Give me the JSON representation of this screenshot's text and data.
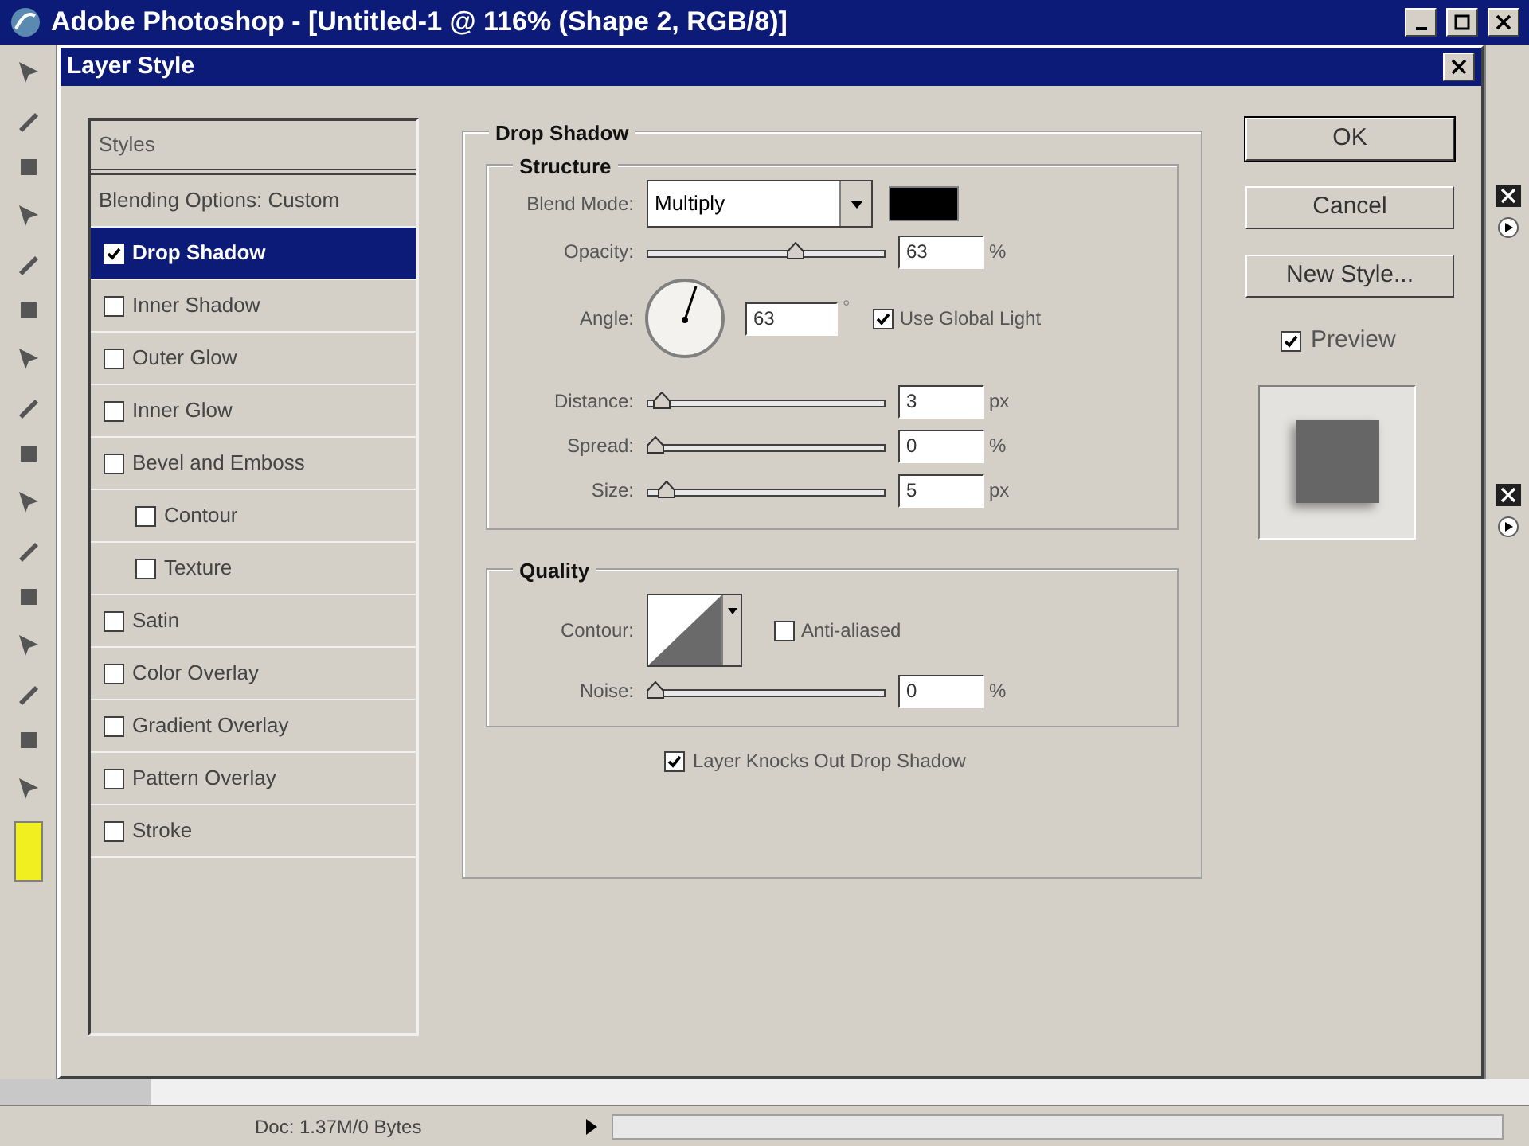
{
  "app_title": "Adobe Photoshop - [Untitled-1 @ 116% (Shape 2, RGB/8)]",
  "dialog": {
    "title": "Layer Style"
  },
  "styles": {
    "header": "Styles",
    "items": [
      {
        "label": "Blending Options: Custom",
        "kind": "plain",
        "selected": false
      },
      {
        "label": "Drop Shadow",
        "kind": "effect",
        "checked": true,
        "selected": true
      },
      {
        "label": "Inner Shadow",
        "kind": "effect",
        "checked": false,
        "selected": false
      },
      {
        "label": "Outer Glow",
        "kind": "effect",
        "checked": false,
        "selected": false
      },
      {
        "label": "Inner Glow",
        "kind": "effect",
        "checked": false,
        "selected": false
      },
      {
        "label": "Bevel and Emboss",
        "kind": "effect",
        "checked": false,
        "selected": false,
        "children": [
          {
            "label": "Contour",
            "kind": "effect",
            "checked": false,
            "selected": false
          },
          {
            "label": "Texture",
            "kind": "effect",
            "checked": false,
            "selected": false
          }
        ]
      },
      {
        "label": "Satin",
        "kind": "effect",
        "checked": false,
        "selected": false
      },
      {
        "label": "Color Overlay",
        "kind": "effect",
        "checked": false,
        "selected": false
      },
      {
        "label": "Gradient Overlay",
        "kind": "effect",
        "checked": false,
        "selected": false
      },
      {
        "label": "Pattern Overlay",
        "kind": "effect",
        "checked": false,
        "selected": false
      },
      {
        "label": "Stroke",
        "kind": "effect",
        "checked": false,
        "selected": false
      }
    ]
  },
  "drop_shadow": {
    "title": "Drop Shadow",
    "structure": {
      "title": "Structure",
      "blend_mode": {
        "label": "Blend Mode:",
        "value": "Multiply",
        "color": "#000000"
      },
      "opacity": {
        "label": "Opacity:",
        "level": 0.63,
        "value": "63",
        "unit": "%"
      },
      "angle": {
        "label": "Angle:",
        "value": "63",
        "unit": "°"
      },
      "use_global_light": {
        "label": "Use Global Light",
        "checked": true
      },
      "distance": {
        "label": "Distance:",
        "level": 0.03,
        "value": "3",
        "unit": "px"
      },
      "spread": {
        "label": "Spread:",
        "level": 0,
        "value": "0",
        "unit": "%"
      },
      "size": {
        "label": "Size:",
        "level": 0.05,
        "value": "5",
        "unit": "px"
      }
    },
    "quality": {
      "title": "Quality",
      "contour": {
        "label": "Contour:"
      },
      "anti_aliased": {
        "label": "Anti-aliased",
        "checked": false
      },
      "noise": {
        "label": "Noise:",
        "level": 0,
        "value": "0",
        "unit": "%"
      }
    },
    "layer_knocks_out": {
      "label": "Layer Knocks Out Drop Shadow",
      "checked": true
    }
  },
  "buttons": [
    "OK",
    "Cancel",
    "New Style..."
  ],
  "preview": {
    "label": "Preview",
    "checked": true
  },
  "status_bar": {
    "doc_info": "Doc: 1.37M/0 Bytes"
  }
}
